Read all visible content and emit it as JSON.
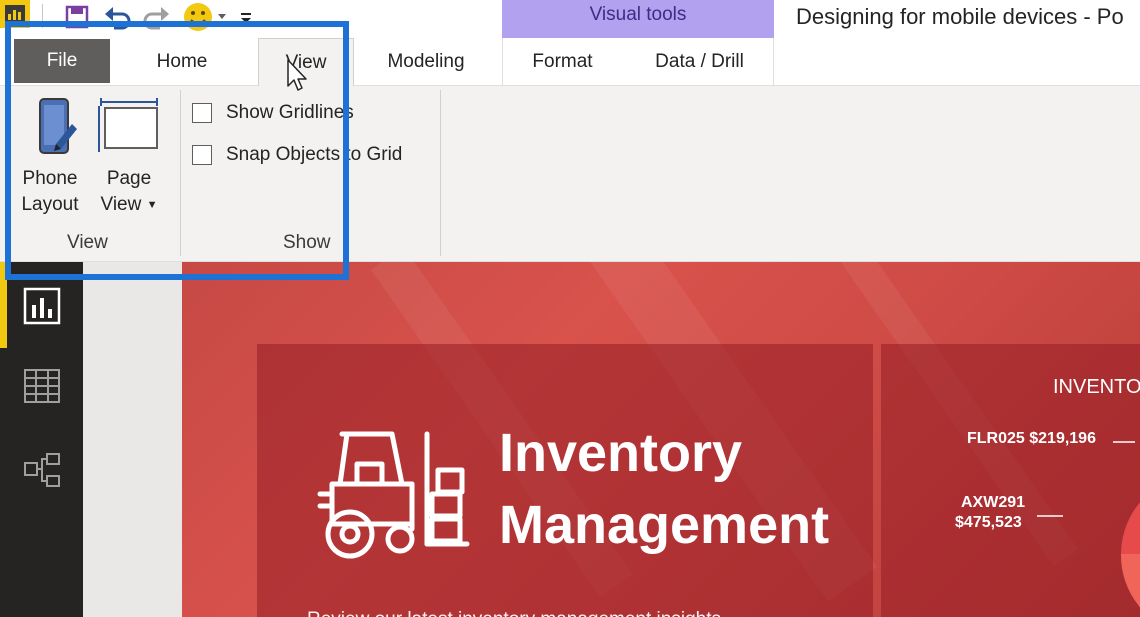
{
  "window": {
    "title": "Designing for mobile devices - Po",
    "context_band": "Visual tools"
  },
  "quick_access": {
    "icons": [
      "powerbi-logo-icon",
      "save-icon",
      "undo-icon",
      "redo-icon",
      "smiley-feedback-icon",
      "customize-dropdown-icon"
    ]
  },
  "tabs": {
    "file": "File",
    "home": "Home",
    "view": "View",
    "modeling": "Modeling",
    "format": "Format",
    "data_drill": "Data / Drill",
    "active": "View"
  },
  "ribbon": {
    "view_group": {
      "label": "View",
      "phone_layout": {
        "line1": "Phone",
        "line2": "Layout"
      },
      "page_view": {
        "line1": "Page",
        "line2": "View"
      }
    },
    "show_group": {
      "label": "Show",
      "show_gridlines": {
        "label": "Show Gridlines",
        "checked": false
      },
      "snap_to_grid": {
        "label": "Snap Objects to Grid",
        "checked": false
      }
    },
    "highlight_color": "#1f72d5"
  },
  "left_nav": {
    "items": [
      "report-view-icon",
      "data-view-icon",
      "relationships-view-icon"
    ],
    "active": "report-view-icon",
    "accent": "#f2c811"
  },
  "report": {
    "title_line1": "Inventory",
    "title_line2": "Management",
    "subtitle": "Review our latest inventory management insights",
    "chart": {
      "title": "INVENTO",
      "labels": {
        "flr025": "FLR025 $219,196",
        "axw291_code": "AXW291",
        "axw291_value": "$475,523"
      }
    },
    "colors": {
      "background": "#d9524c",
      "card": "#961e24"
    }
  }
}
